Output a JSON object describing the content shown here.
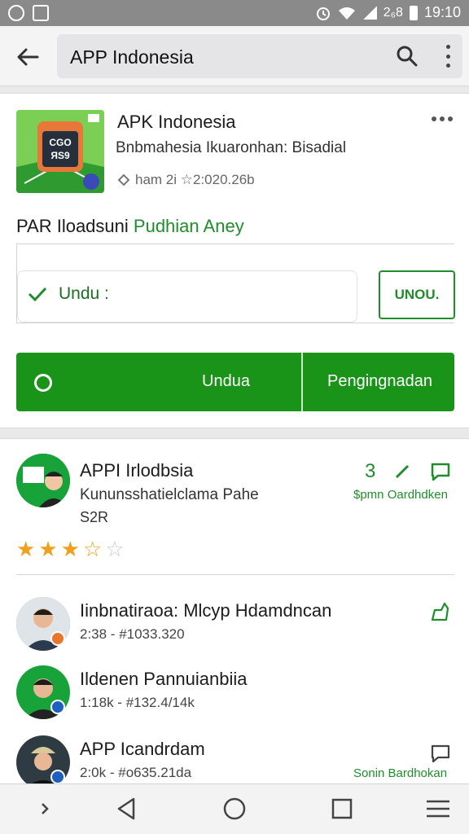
{
  "status_bar": {
    "icons": [
      "notification-icon",
      "gallery-icon",
      "alarm-icon",
      "wifi-icon",
      "signal-icon"
    ],
    "network": "2₆8",
    "time": "19:10"
  },
  "toolbar": {
    "title": "APP Indonesia",
    "icons": [
      "back-arrow-icon",
      "search-icon",
      "more-vert-icon"
    ]
  },
  "app_card": {
    "title": "APK Indonesia",
    "subtitle": "Bnbmahesia Ikuaronhan: Bisadial",
    "meta": "ham 2i ☆2:020.26b",
    "package_label": "PAR Iloadsuni",
    "package_value": "Pudhian Aney",
    "download_status": "Undu :",
    "undu_button": "UNOU.",
    "primary_button": "Undua",
    "secondary_button": "Pengingnadan"
  },
  "developer_card": {
    "name": "APPI Irlodbsia",
    "subtitle": "Kununsshatielclama Pahe",
    "size": "S2R",
    "count": "3",
    "action_label": "$pmn Oardhdken",
    "rating": 3.5,
    "accent": "#1f8e2a",
    "star_color": "#f0a01c"
  },
  "list": [
    {
      "name": "Iinbnatiraoa: Mlcyp Hdamdncan",
      "meta": "2:38 - #1033.320",
      "avatar_bg": "#6a7a86",
      "badge": "#e8762b"
    },
    {
      "name": "Ildenen Pannuianbiia",
      "meta": "1:18k - #132.4/14k",
      "avatar_bg": "#18a23a",
      "badge": "#1f5fbf"
    },
    {
      "name": "APP Icandrdam",
      "meta": "2:0k - #o635.21da",
      "avatar_bg": "#2f3b42",
      "badge": "#1f5fbf",
      "action_label": "Sonin Bardhokan"
    }
  ],
  "navbar": {
    "icons": [
      "chevron-right-icon",
      "back-triangle-icon",
      "home-circle-icon",
      "recents-square-icon",
      "menu-lines-icon"
    ]
  }
}
